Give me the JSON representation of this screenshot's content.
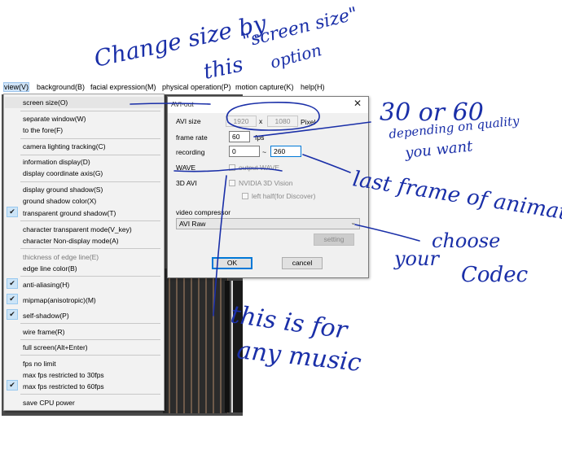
{
  "menubar": {
    "items": [
      {
        "label": "view(V)"
      },
      {
        "label": "background(B)"
      },
      {
        "label": "facial expression(M)"
      },
      {
        "label": "physical operation(P)"
      },
      {
        "label": "motion capture(K)"
      },
      {
        "label": "help(H)"
      }
    ]
  },
  "view_menu": {
    "items": [
      {
        "label": "screen size(O)",
        "checked": false
      },
      {
        "label": "separate window(W)",
        "checked": false
      },
      {
        "label": "to the fore(F)",
        "checked": false
      },
      {
        "label": "camera  lighting tracking(C)",
        "checked": false
      },
      {
        "label": "information display(D)",
        "checked": false
      },
      {
        "label": "display coordinate axis(G)",
        "checked": false
      },
      {
        "label": "display ground shadow(S)",
        "checked": false
      },
      {
        "label": "ground shadow color(X)",
        "checked": false
      },
      {
        "label": "transparent ground shadow(T)",
        "checked": true
      },
      {
        "label": "character transparent mode(V_key)",
        "checked": false
      },
      {
        "label": "character Non-display mode(A)",
        "checked": false
      },
      {
        "label": "thickness of edge line(E)",
        "checked": false,
        "disabled": true
      },
      {
        "label": "edge line color(B)",
        "checked": false
      },
      {
        "label": "anti-aliasing(H)",
        "checked": true
      },
      {
        "label": "mipmap(anisotropic)(M)",
        "checked": true
      },
      {
        "label": "self-shadow(P)",
        "checked": true
      },
      {
        "label": "wire frame(R)",
        "checked": false
      },
      {
        "label": "full screen(Alt+Enter)",
        "checked": false
      },
      {
        "label": "fps no limit",
        "checked": false
      },
      {
        "label": "max fps restricted to 30fps",
        "checked": false
      },
      {
        "label": "max fps restricted to 60fps",
        "checked": true
      },
      {
        "label": "save CPU power",
        "checked": false
      }
    ]
  },
  "dialog": {
    "title": "AVI-out",
    "close_glyph": "✕",
    "avi_size_label": "AVI size",
    "width_value": "1920",
    "x_label": "x",
    "height_value": "1080",
    "pixel_label": "Pixel",
    "frame_rate_label": "frame rate",
    "frame_rate_value": "60",
    "fps_label": "fps",
    "recording_label": "recording",
    "recording_start": "0",
    "tilde": "~",
    "recording_end": "260",
    "wave_label": "WAVE",
    "output_wave_label": "output WAVE",
    "avi3d_label": "3D AVI",
    "nvidia_label": "NVIDIA 3D Vision",
    "left_half_label": "left half(for Discover)",
    "video_compressor_label": "video compressor",
    "compressor_value": "AVI Raw",
    "setting_label": "setting",
    "ok_label": "OK",
    "cancel_label": "cancel"
  },
  "annotations": {
    "a1": "Change size by",
    "a2": "\"screen size\"",
    "a3": "this",
    "a4": "option",
    "a5": "30 or 60",
    "a6": "depending on quality",
    "a7": "you want",
    "a8": "last frame of animation",
    "a9": "choose",
    "a10": "your",
    "a11": "Codec",
    "a12": "this is for",
    "a13": "any music"
  },
  "colors": {
    "ink": "#1a2fa8",
    "check_bg": "#cce4f7",
    "accent": "#0078d7"
  }
}
